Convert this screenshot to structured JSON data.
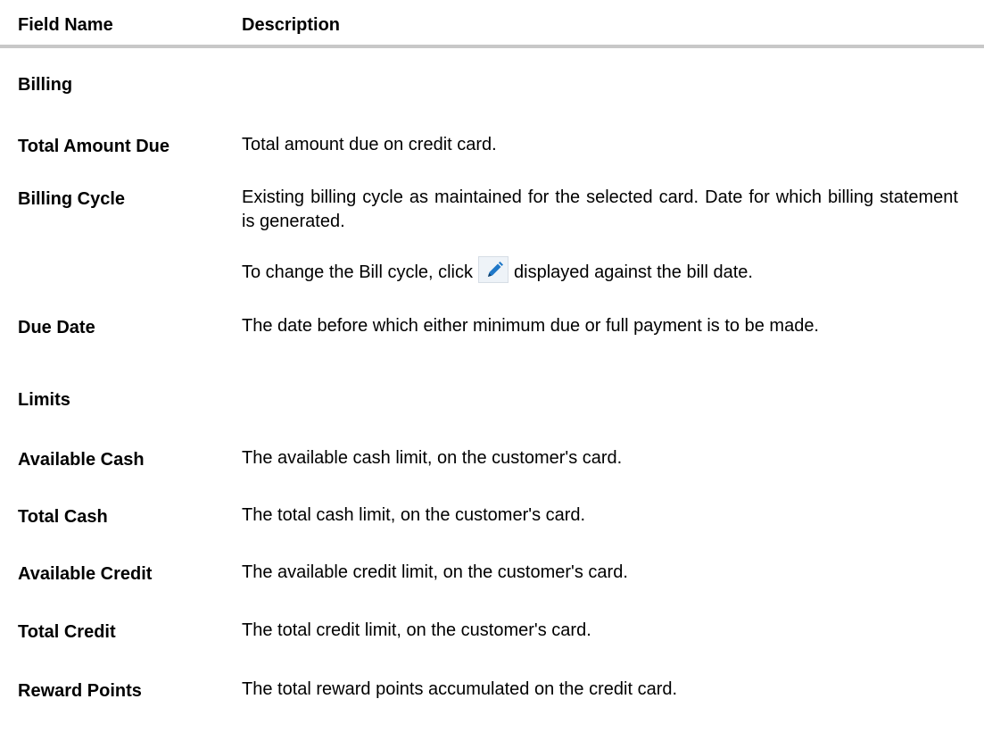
{
  "header": {
    "field_name": "Field Name",
    "description": "Description"
  },
  "sections": {
    "billing": "Billing",
    "limits": "Limits"
  },
  "rows": {
    "total_amount_due": {
      "field": "Total Amount Due",
      "desc": "Total amount due on credit card."
    },
    "billing_cycle": {
      "field": "Billing Cycle",
      "desc": "Existing billing cycle as maintained for the selected card. Date for which billing statement is generated.",
      "desc2_before": "To change the Bill cycle, click",
      "desc2_after": "displayed against the bill date.",
      "icon": "pencil-edit-icon"
    },
    "due_date": {
      "field": "Due Date",
      "desc": "The date before which either minimum due or full payment is to be made."
    },
    "available_cash": {
      "field": "Available Cash",
      "desc": "The available cash limit, on the customer's card."
    },
    "total_cash": {
      "field": "Total Cash",
      "desc": "The total cash limit, on the customer's card."
    },
    "available_credit": {
      "field": "Available Credit",
      "desc": "The available credit limit, on the customer's card."
    },
    "total_credit": {
      "field": "Total Credit",
      "desc": "The total credit limit, on the customer's card."
    },
    "reward_points": {
      "field": "Reward Points",
      "desc": "The total reward points accumulated on the credit card."
    }
  },
  "colors": {
    "header_rule": "#c8c8c8",
    "icon_blue": "#1f78c8"
  }
}
